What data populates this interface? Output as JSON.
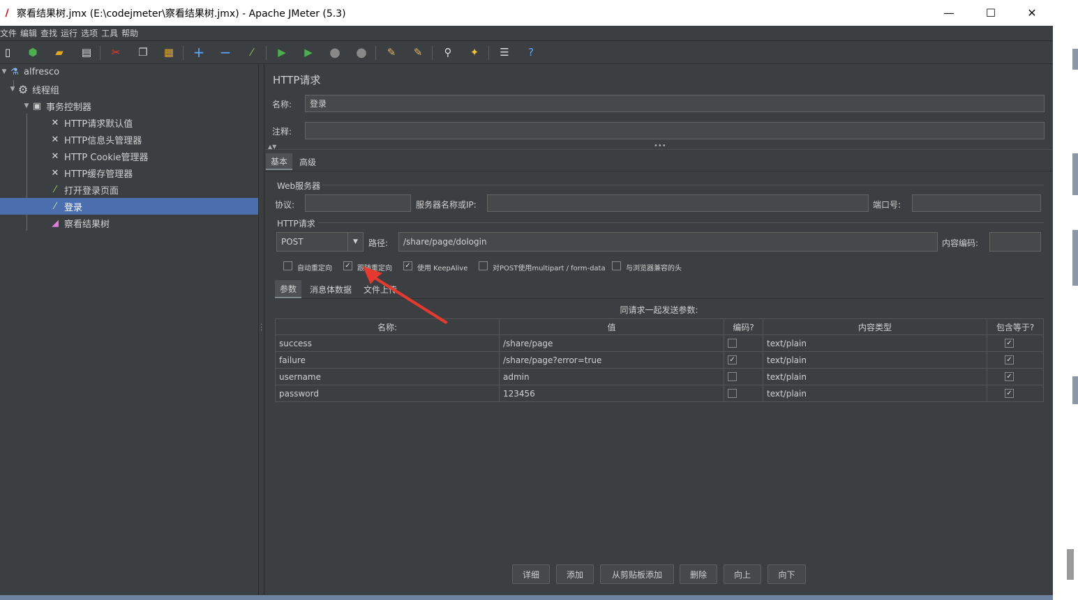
{
  "window": {
    "title": "察看结果树.jmx (E:\\codejmeter\\察看结果树.jmx) - Apache JMeter (5.3)",
    "minimize": "—",
    "maximize": "☐",
    "close": "✕"
  },
  "menu": [
    "文件",
    "编辑",
    "查找",
    "运行",
    "选项",
    "工具",
    "帮助"
  ],
  "tree": {
    "root": "alfresco",
    "thread_group": "线程组",
    "controller": "事务控制器",
    "items": [
      "HTTP请求默认值",
      "HTTP信息头管理器",
      "HTTP Cookie管理器",
      "HTTP缓存管理器",
      "打开登录页面",
      "登录",
      "察看结果树"
    ]
  },
  "panel": {
    "heading": "HTTP请求",
    "name_label": "名称:",
    "name_value": "登录",
    "comment_label": "注释:",
    "comment_value": "",
    "tabs": [
      "基本",
      "高级"
    ],
    "web_server_group": "Web服务器",
    "protocol_label": "协议:",
    "protocol_value": "",
    "server_label": "服务器名称或IP:",
    "server_value": "",
    "port_label": "端口号:",
    "port_value": "",
    "http_group": "HTTP请求",
    "method": "POST",
    "path_label": "路径:",
    "path_value": "/share/page/dologin",
    "encoding_label": "内容编码:",
    "encoding_value": "",
    "options": [
      {
        "label": "自动重定向",
        "checked": false
      },
      {
        "label": "跟随重定向",
        "checked": true
      },
      {
        "label": "使用 KeepAlive",
        "checked": true
      },
      {
        "label": "对POST使用multipart / form-data",
        "checked": false
      },
      {
        "label": "与浏览器兼容的头",
        "checked": false
      }
    ],
    "sub_tabs": [
      "参数",
      "消息体数据",
      "文件上传"
    ],
    "params_caption": "同请求一起发送参数:",
    "columns": [
      "名称:",
      "值",
      "编码?",
      "内容类型",
      "包含等于?"
    ],
    "rows": [
      {
        "name": "success",
        "value": "/share/page",
        "encode": false,
        "content_type": "text/plain",
        "include_equals": true
      },
      {
        "name": "failure",
        "value": "/share/page?error=true",
        "encode": true,
        "content_type": "text/plain",
        "include_equals": true
      },
      {
        "name": "username",
        "value": "admin",
        "encode": false,
        "content_type": "text/plain",
        "include_equals": true
      },
      {
        "name": "password",
        "value": "123456",
        "encode": false,
        "content_type": "text/plain",
        "include_equals": true
      }
    ],
    "buttons": [
      "详细",
      "添加",
      "从剪贴板添加",
      "删除",
      "向上",
      "向下"
    ]
  },
  "colors": {
    "background": "#3c3f41",
    "selection": "#4b6eaf",
    "annotation_arrow": "#e8392e"
  }
}
